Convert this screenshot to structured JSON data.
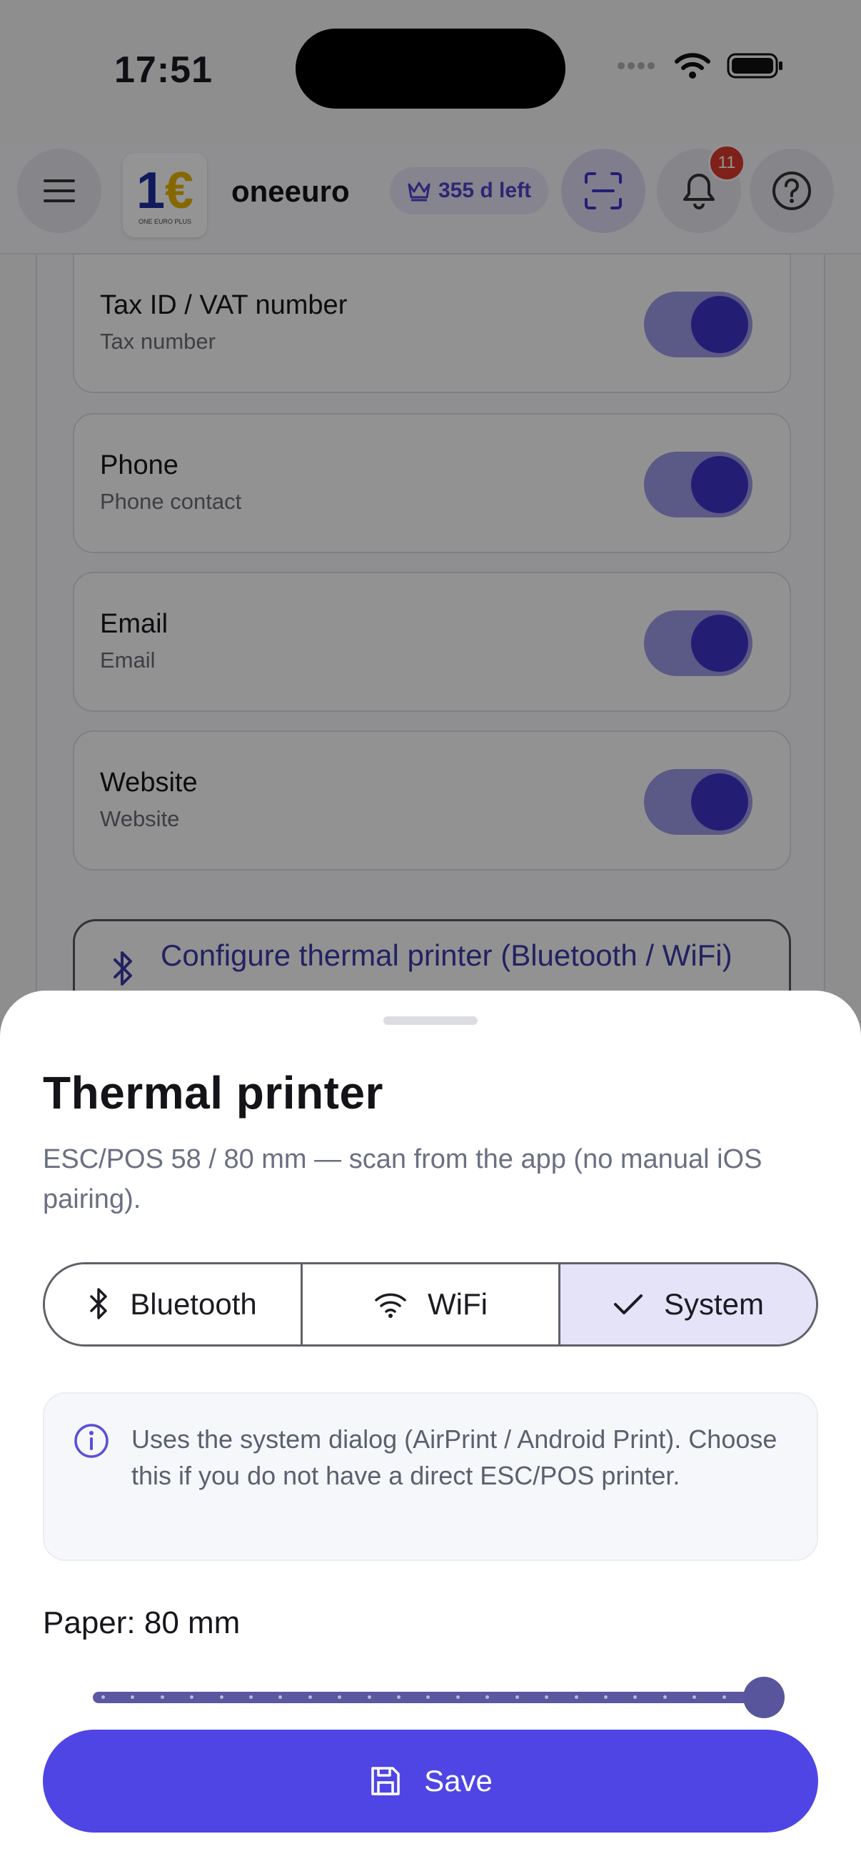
{
  "status_bar": {
    "time": "17:51"
  },
  "header": {
    "brand": "oneeuro",
    "logo_text": "ONE EURO PLUS",
    "trial_text": "355 d left",
    "notification_count": "11"
  },
  "fields": [
    {
      "title": "Tax ID / VAT number",
      "subtitle": "Tax number",
      "enabled": true
    },
    {
      "title": "Phone",
      "subtitle": "Phone contact",
      "enabled": true
    },
    {
      "title": "Email",
      "subtitle": "Email",
      "enabled": true
    },
    {
      "title": "Website",
      "subtitle": "Website",
      "enabled": true
    }
  ],
  "printer_button": {
    "label": "Configure thermal printer (Bluetooth / WiFi)"
  },
  "sheet": {
    "title": "Thermal printer",
    "description": "ESC/POS 58 / 80 mm — scan from the app (no manual iOS pairing).",
    "segments": [
      {
        "label": "Bluetooth",
        "icon": "bluetooth-icon",
        "selected": false
      },
      {
        "label": "WiFi",
        "icon": "wifi-icon",
        "selected": false
      },
      {
        "label": "System",
        "icon": "check-icon",
        "selected": true
      }
    ],
    "info_text": "Uses the system dialog (AirPrint / Android Print). Choose this if you do not have a direct ESC/POS printer.",
    "paper_label": "Paper: 80 mm",
    "paper_slider": {
      "min": 58,
      "max": 80,
      "value": 80
    },
    "save_label": "Save"
  },
  "colors": {
    "accent": "#4f45e4",
    "segment_selected": "#e5e3f7",
    "badge": "#d93a2b"
  }
}
